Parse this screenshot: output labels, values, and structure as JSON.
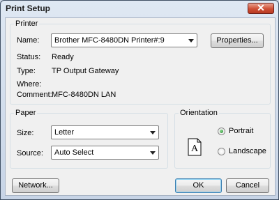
{
  "window": {
    "title": "Print Setup",
    "close_glyph": "✕"
  },
  "printer": {
    "legend": "Printer",
    "name_label": "Name:",
    "name_value": "Brother MFC-8480DN Printer#:9",
    "properties_label": "Properties...",
    "status_label": "Status:",
    "status_value": "Ready",
    "type_label": "Type:",
    "type_value": "TP Output Gateway",
    "where_label": "Where:",
    "where_value": "",
    "comment_label": "Comment:",
    "comment_value": "MFC-8480DN LAN"
  },
  "paper": {
    "legend": "Paper",
    "size_label": "Size:",
    "size_value": "Letter",
    "source_label": "Source:",
    "source_value": "Auto Select"
  },
  "orientation": {
    "legend": "Orientation",
    "page_glyph": "A",
    "options": [
      {
        "label": "Portrait",
        "checked": true
      },
      {
        "label": "Landscape",
        "checked": false
      }
    ]
  },
  "buttons": {
    "network": "Network...",
    "ok": "OK",
    "cancel": "Cancel"
  },
  "colors": {
    "title_bar": "#c7d4e6",
    "close_button": "#cf4f35",
    "dialog_face": "#f0f0f0",
    "default_button_border": "#3c7fb1"
  },
  "icons": [
    "close-icon",
    "dropdown-arrow-icon",
    "portrait-page-icon",
    "radio-button-icon"
  ]
}
